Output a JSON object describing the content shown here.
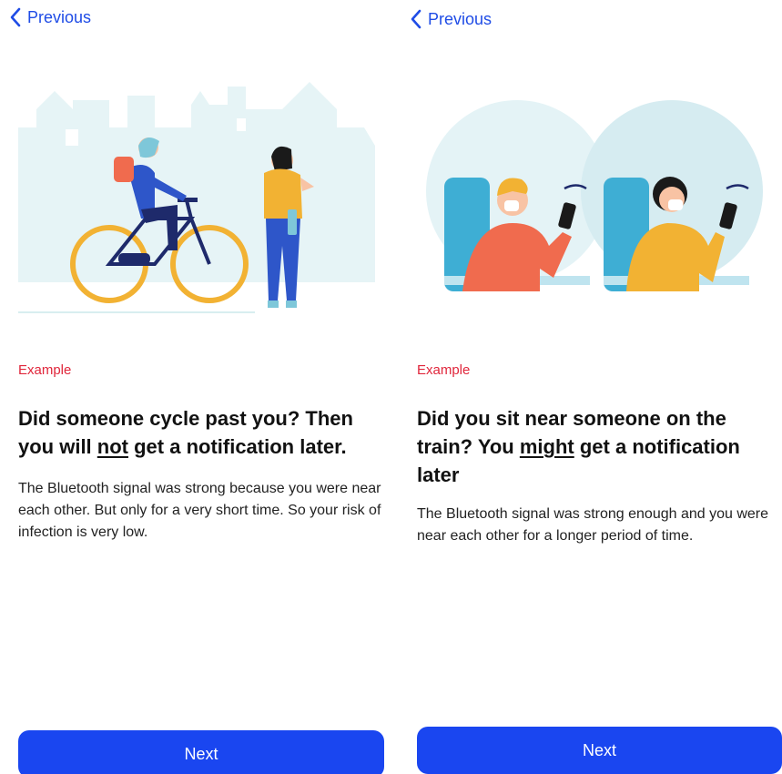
{
  "colors": {
    "accent": "#1a46f0",
    "link": "#1f4ce6",
    "eyebrow": "#e0263b"
  },
  "screens": [
    {
      "back_label": "Previous",
      "eyebrow": "Example",
      "heading_pre": "Did someone cycle past you? Then you will ",
      "heading_emph": "not",
      "heading_post": " get a notification later.",
      "body": "The Bluetooth signal was strong because you were near each other. But only for a very short time. So your risk of infection is very low.",
      "next_label": "Next"
    },
    {
      "back_label": "Previous",
      "eyebrow": "Example",
      "heading_pre": "Did you sit near someone on the train? You ",
      "heading_emph": "might",
      "heading_post": " get a notification later",
      "body": "The Bluetooth signal was strong enough and you were near each other for a longer period of time.",
      "next_label": "Next"
    }
  ]
}
